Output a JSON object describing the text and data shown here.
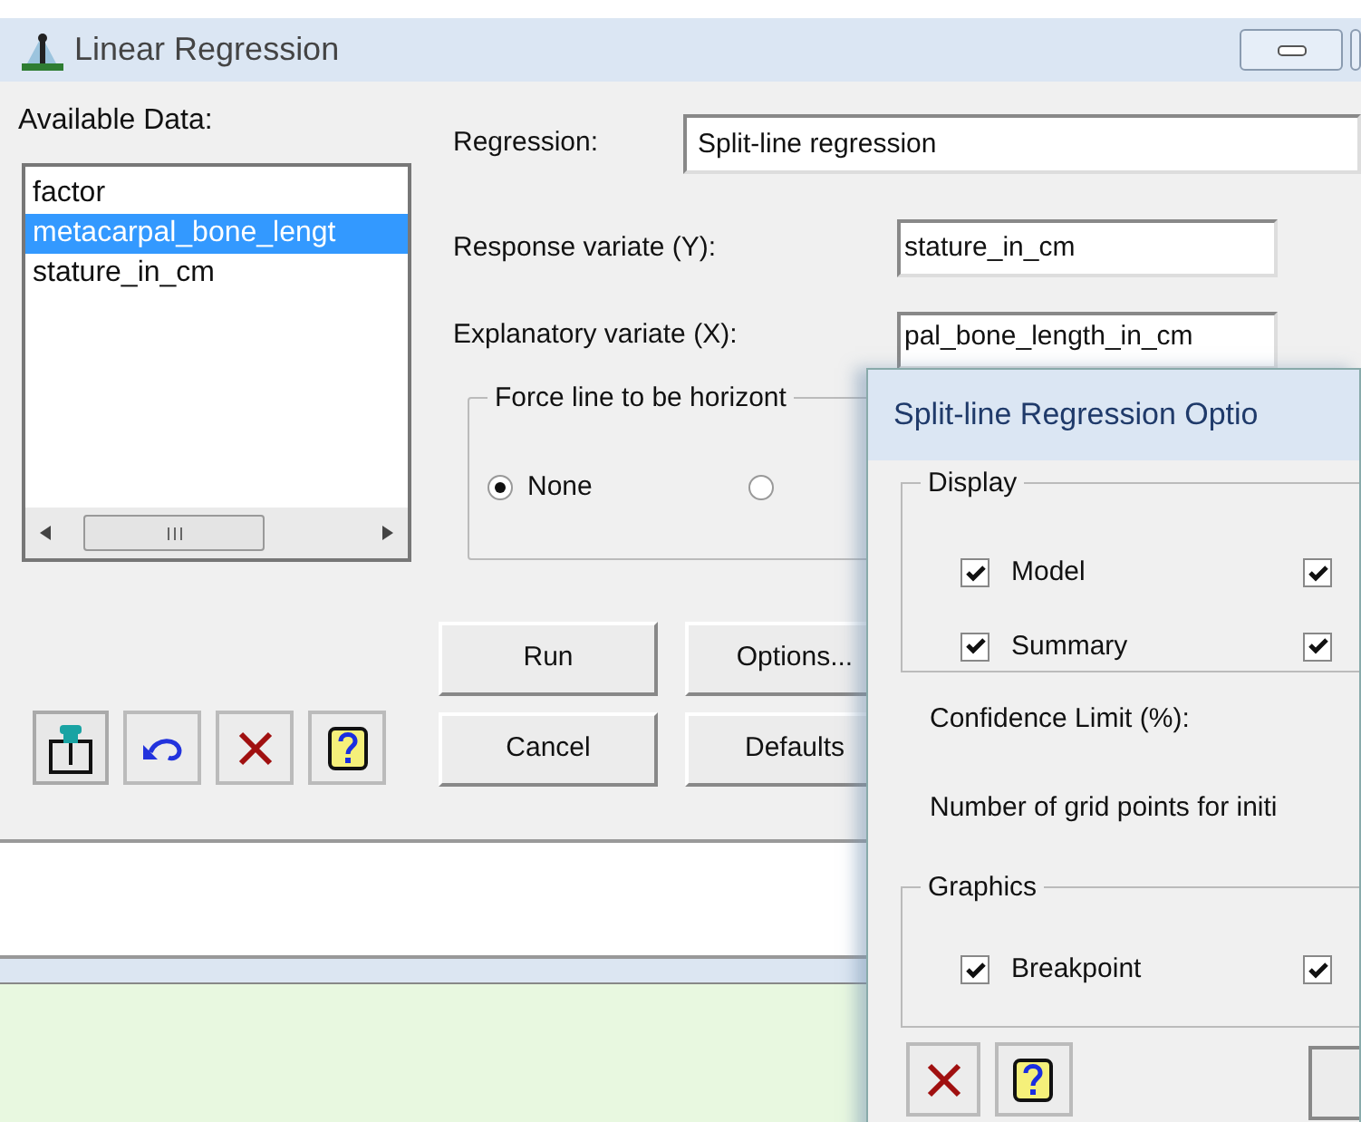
{
  "window": {
    "title": "Linear Regression"
  },
  "available_data": {
    "label": "Available Data:",
    "items": [
      {
        "text": "factor",
        "selected": false
      },
      {
        "text": "metacarpal_bone_lengt",
        "selected": true
      },
      {
        "text": "stature_in_cm",
        "selected": false
      }
    ]
  },
  "regression": {
    "label": "Regression:",
    "value": "Split-line regression"
  },
  "response": {
    "label": "Response variate (Y):",
    "value": "stature_in_cm"
  },
  "explanatory": {
    "label": "Explanatory variate (X):",
    "value": "pal_bone_length_in_cm"
  },
  "force_group": {
    "title": "Force line to be horizont",
    "options": [
      {
        "label": "None",
        "selected": true
      },
      {
        "selected": false
      }
    ]
  },
  "buttons": [
    "Run",
    "Options...",
    "Cancel",
    "Defaults"
  ],
  "options_dialog": {
    "title": "Split-line Regression Optio",
    "display": {
      "title": "Display",
      "checkboxes": [
        {
          "label": "Model",
          "checked": true
        },
        {
          "checked": true
        },
        {
          "label": "Summary",
          "checked": true
        },
        {
          "checked": true
        }
      ]
    },
    "confidence_label": "Confidence Limit (%):",
    "grid_points_label": "Number of grid points for initi",
    "graphics": {
      "title": "Graphics",
      "checkboxes": [
        {
          "label": "Breakpoint",
          "checked": true
        },
        {
          "checked": true
        }
      ]
    }
  }
}
